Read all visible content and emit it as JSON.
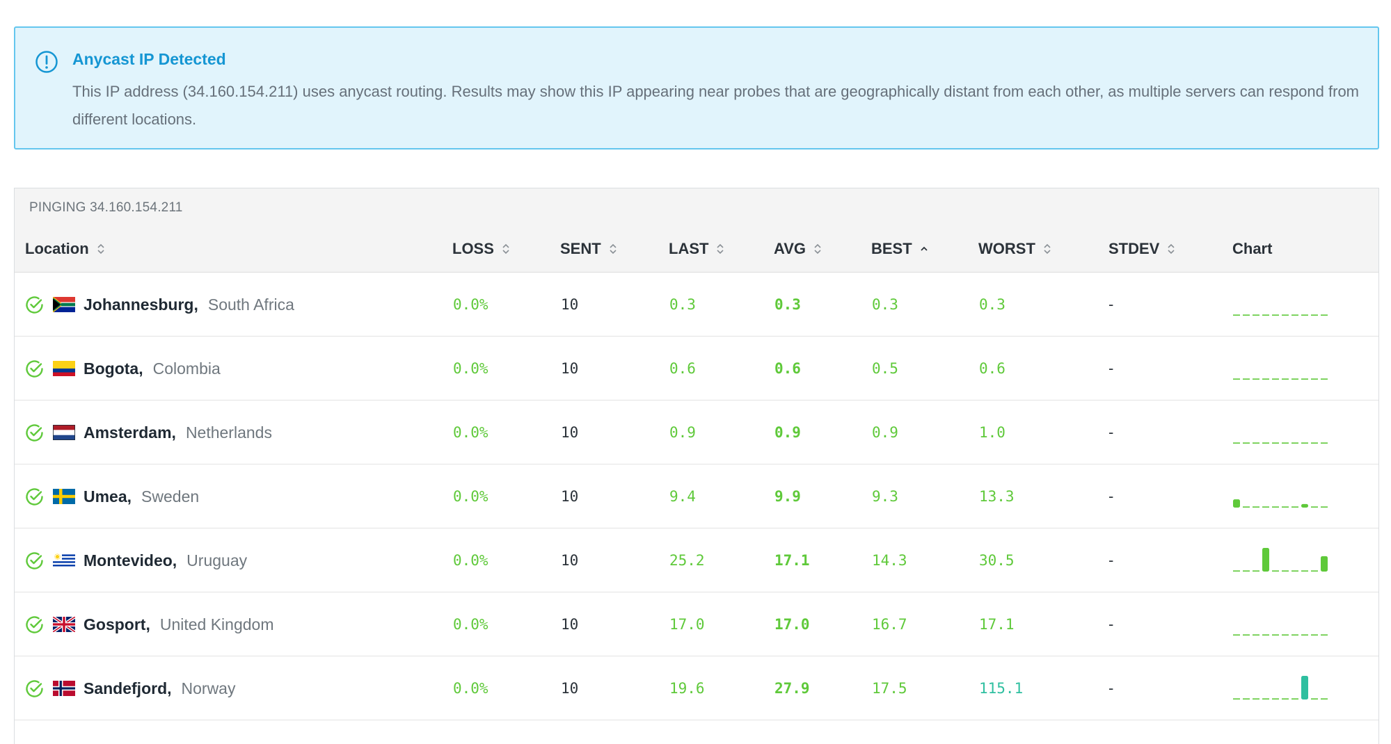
{
  "alert": {
    "title": "Anycast IP Detected",
    "body": "This IP address (34.160.154.211) uses anycast routing. Results may show this IP appearing near probes that are geographically distant from each other, as multiple servers can respond from different locations.",
    "icon": "info-circle-icon",
    "color": "#1596d3"
  },
  "table": {
    "caption": "PINGING 34.160.154.211",
    "headers": {
      "location": "Location",
      "loss": "LOSS",
      "sent": "SENT",
      "last": "LAST",
      "avg": "AVG",
      "best": "BEST",
      "worst": "WORST",
      "stdev": "STDEV",
      "chart": "Chart"
    },
    "sorted_column": "best",
    "sort_direction": "ascending",
    "rows": [
      {
        "status": "ok",
        "flag": "ZA",
        "city": "Johannesburg,",
        "country": "South Africa",
        "loss": "0.0%",
        "sent": "10",
        "last": "0.3",
        "avg": "0.3",
        "best": "0.3",
        "worst": "0.3",
        "stdev": "-",
        "chart": [
          0,
          0,
          0,
          0,
          0,
          0,
          0,
          0,
          0,
          0
        ]
      },
      {
        "status": "ok",
        "flag": "CO",
        "city": "Bogota,",
        "country": "Colombia",
        "loss": "0.0%",
        "sent": "10",
        "last": "0.6",
        "avg": "0.6",
        "best": "0.5",
        "worst": "0.6",
        "stdev": "-",
        "chart": [
          0,
          0,
          0,
          0,
          0,
          0,
          0,
          0,
          0,
          0
        ]
      },
      {
        "status": "ok",
        "flag": "NL",
        "city": "Amsterdam,",
        "country": "Netherlands",
        "loss": "0.0%",
        "sent": "10",
        "last": "0.9",
        "avg": "0.9",
        "best": "0.9",
        "worst": "1.0",
        "stdev": "-",
        "chart": [
          0,
          0,
          0,
          0,
          0,
          0,
          0,
          0,
          0,
          0
        ]
      },
      {
        "status": "ok",
        "flag": "SE",
        "city": "Umea,",
        "country": "Sweden",
        "loss": "0.0%",
        "sent": "10",
        "last": "9.4",
        "avg": "9.9",
        "best": "9.3",
        "worst": "13.3",
        "stdev": "-",
        "chart": [
          0.35,
          0,
          0,
          0,
          0,
          0,
          0,
          0.15,
          0,
          0
        ]
      },
      {
        "status": "ok",
        "flag": "UY",
        "city": "Montevideo,",
        "country": "Uruguay",
        "loss": "0.0%",
        "sent": "10",
        "last": "25.2",
        "avg": "17.1",
        "best": "14.3",
        "worst": "30.5",
        "stdev": "-",
        "chart": [
          0,
          0,
          0,
          1,
          0,
          0,
          0,
          0,
          0,
          0.65
        ]
      },
      {
        "status": "ok",
        "flag": "GB",
        "city": "Gosport,",
        "country": "United Kingdom",
        "loss": "0.0%",
        "sent": "10",
        "last": "17.0",
        "avg": "17.0",
        "best": "16.7",
        "worst": "17.1",
        "stdev": "-",
        "chart": [
          0,
          0,
          0,
          0,
          0,
          0,
          0,
          0,
          0,
          0
        ]
      },
      {
        "status": "ok",
        "flag": "NO",
        "city": "Sandefjord,",
        "country": "Norway",
        "loss": "0.0%",
        "sent": "10",
        "last": "19.6",
        "avg": "27.9",
        "best": "17.5",
        "worst": "115.1",
        "stdev": "-",
        "chart": [
          0,
          0,
          0,
          0,
          0,
          0,
          0,
          1,
          0,
          0
        ],
        "worst_color": "#2fbfa0"
      }
    ],
    "colors": {
      "good": "#5fc93a",
      "high": "#2fbfa0",
      "check": "#5fc93a"
    }
  }
}
